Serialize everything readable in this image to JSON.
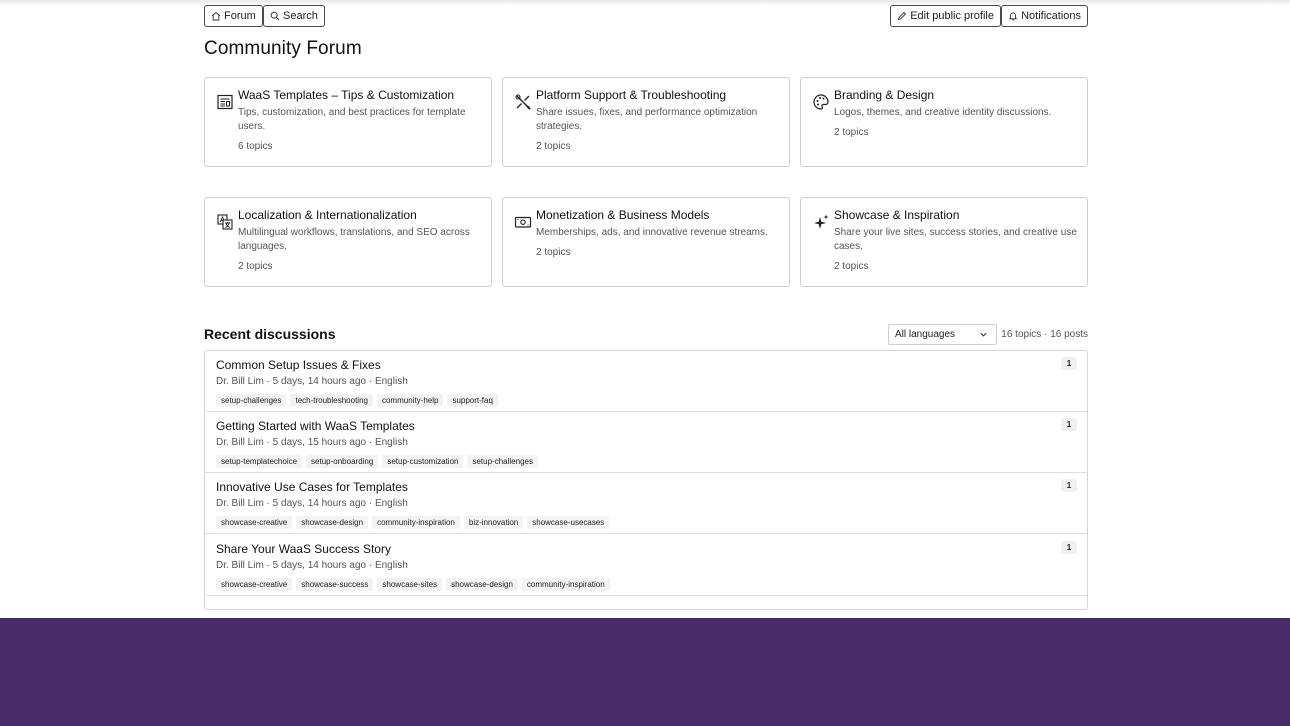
{
  "toolbar": {
    "forum_label": "Forum",
    "search_label": "Search",
    "edit_profile_label": "Edit public profile",
    "notifications_label": "Notifications"
  },
  "page_title": "Community Forum",
  "categories": [
    {
      "name": "WaaS Templates – Tips & Customization",
      "description": "Tips, customization, and best practices for template users.",
      "count": "6 topics",
      "icon": "document-icon"
    },
    {
      "name": "Platform Support & Troubleshooting",
      "description": "Share issues, fixes, and performance optimization strategies.",
      "count": "2 topics",
      "icon": "tools-icon"
    },
    {
      "name": "Branding & Design",
      "description": "Logos, themes, and creative identity discussions.",
      "count": "2 topics",
      "icon": "palette-icon"
    },
    {
      "name": "Localization & Internationalization",
      "description": "Multilingual workflows, translations, and SEO across languages.",
      "count": "2 topics",
      "icon": "translate-icon"
    },
    {
      "name": "Monetization & Business Models",
      "description": "Memberships, ads, and innovative revenue streams.",
      "count": "2 topics",
      "icon": "cash-icon"
    },
    {
      "name": "Showcase & Inspiration",
      "description": "Share your live sites, success stories, and creative use cases.",
      "count": "2 topics",
      "icon": "sparkle-icon"
    }
  ],
  "recent": {
    "title": "Recent discussions",
    "language_filter": "All languages",
    "counts": "16 topics · 16 posts",
    "topics": [
      {
        "title": "Common Setup Issues & Fixes",
        "meta": "Dr. Bill Lim · 5 days, 14 hours ago · English",
        "replies": "1",
        "tags": [
          "setup-challenges",
          "tech-troubleshooting",
          "community-help",
          "support-faq"
        ]
      },
      {
        "title": "Getting Started with WaaS Templates",
        "meta": "Dr. Bill Lim · 5 days, 15 hours ago · English",
        "replies": "1",
        "tags": [
          "setup-templatechoice",
          "setup-onboarding",
          "setup-customization",
          "setup-challenges"
        ]
      },
      {
        "title": "Innovative Use Cases for Templates",
        "meta": "Dr. Bill Lim · 5 days, 14 hours ago · English",
        "replies": "1",
        "tags": [
          "showcase-creative",
          "showcase-design",
          "community-inspiration",
          "biz-innovation",
          "showcase-usecases"
        ]
      },
      {
        "title": "Share Your WaaS Success Story",
        "meta": "Dr. Bill Lim · 5 days, 14 hours ago · English",
        "replies": "1",
        "tags": [
          "showcase-creative",
          "showcase-success",
          "showcase-sites",
          "showcase-design",
          "community-inspiration"
        ]
      }
    ]
  },
  "colors": {
    "footer": "#482a69",
    "border": "#d0d0d0"
  }
}
